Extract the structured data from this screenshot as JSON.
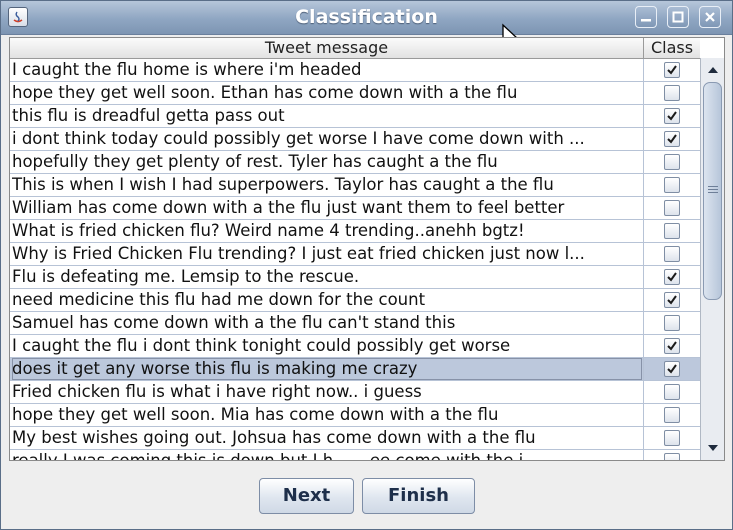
{
  "window": {
    "title": "Classification"
  },
  "table": {
    "columns": [
      "Tweet message",
      "Class"
    ],
    "rows": [
      {
        "message": "I caught the flu home is where i'm headed",
        "checked": true
      },
      {
        "message": "hope they get well soon. Ethan has come down with a the flu",
        "checked": false
      },
      {
        "message": "this flu is dreadful getta pass out",
        "checked": true
      },
      {
        "message": "i dont think today could possibly get worse I have come down with ...",
        "checked": true
      },
      {
        "message": "hopefully they get plenty of rest. Tyler has caught a the flu",
        "checked": false
      },
      {
        "message": "This is when I wish I had superpowers. Taylor has caught a the flu",
        "checked": false
      },
      {
        "message": "William has come down with a the flu just want them to feel better",
        "checked": false
      },
      {
        "message": "What is fried chicken flu? Weird name 4 trending..anehh bgtz!",
        "checked": false
      },
      {
        "message": "Why is Fried Chicken Flu trending? I just eat fried chicken just now l...",
        "checked": false
      },
      {
        "message": "Flu is defeating me. Lemsip to the rescue.",
        "checked": true
      },
      {
        "message": "need medicine this flu had me down for the count",
        "checked": true
      },
      {
        "message": "Samuel has come down with a the flu can't stand this",
        "checked": false
      },
      {
        "message": "I caught the flu i dont think tonight could possibly get worse",
        "checked": true
      },
      {
        "message": "does it get any worse this flu is making me crazy",
        "checked": true,
        "selected": true
      },
      {
        "message": "Fried chicken flu is what i have right now.. i guess",
        "checked": false
      },
      {
        "message": "hope they get well soon. Mia has come down with a the flu",
        "checked": false
      },
      {
        "message": "My best wishes going out. Johsua has come down with a the flu",
        "checked": false
      },
      {
        "message": "really I was coming this is down but I h... ...ee come with the i...",
        "checked": false
      }
    ]
  },
  "buttons": {
    "next": "Next",
    "finish": "Finish"
  },
  "colors": {
    "titlebar": "#8fa6c2",
    "selected_row": "#bcc8dc",
    "grid": "#b7c3d6"
  }
}
